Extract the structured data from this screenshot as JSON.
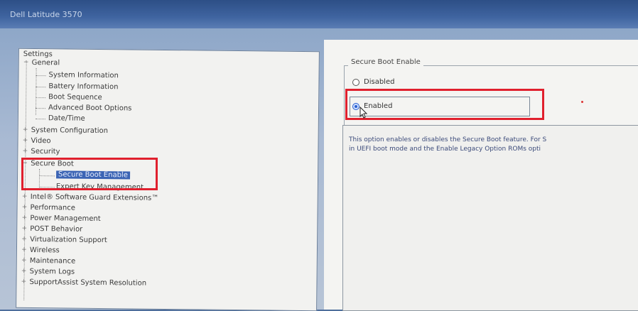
{
  "window": {
    "title": "Dell Latitude 3570"
  },
  "tree": {
    "root_label": "Settings",
    "items": [
      {
        "label": "General",
        "expander": "−"
      },
      {
        "label": "System Information"
      },
      {
        "label": "Battery Information"
      },
      {
        "label": "Boot Sequence"
      },
      {
        "label": "Advanced Boot Options"
      },
      {
        "label": "Date/Time"
      },
      {
        "label": "System Configuration",
        "expander": "+"
      },
      {
        "label": "Video",
        "expander": "+"
      },
      {
        "label": "Security",
        "expander": "+"
      },
      {
        "label": "Secure Boot",
        "expander": "−"
      },
      {
        "label": "Secure Boot Enable",
        "selected": true
      },
      {
        "label": "Expert Key Management"
      },
      {
        "label": "Intel® Software Guard Extensions™",
        "expander": "+"
      },
      {
        "label": "Performance",
        "expander": "+"
      },
      {
        "label": "Power Management",
        "expander": "+"
      },
      {
        "label": "POST Behavior",
        "expander": "+"
      },
      {
        "label": "Virtualization Support",
        "expander": "+"
      },
      {
        "label": "Wireless",
        "expander": "+"
      },
      {
        "label": "Maintenance",
        "expander": "+"
      },
      {
        "label": "System Logs",
        "expander": "+"
      },
      {
        "label": "SupportAssist System Resolution",
        "expander": "+"
      }
    ]
  },
  "detail": {
    "group_title": "Secure Boot Enable",
    "options": [
      {
        "label": "Disabled",
        "checked": false
      },
      {
        "label": "Enabled",
        "checked": true
      }
    ],
    "description_line1": "This option enables or disables the Secure Boot feature. For S",
    "description_line2": "in UEFI boot mode and the Enable Legacy Option ROMs opti"
  },
  "colors": {
    "highlight_box": "#e0202e",
    "selection": "#3b64b4",
    "title_bar": "#2d4f86"
  }
}
